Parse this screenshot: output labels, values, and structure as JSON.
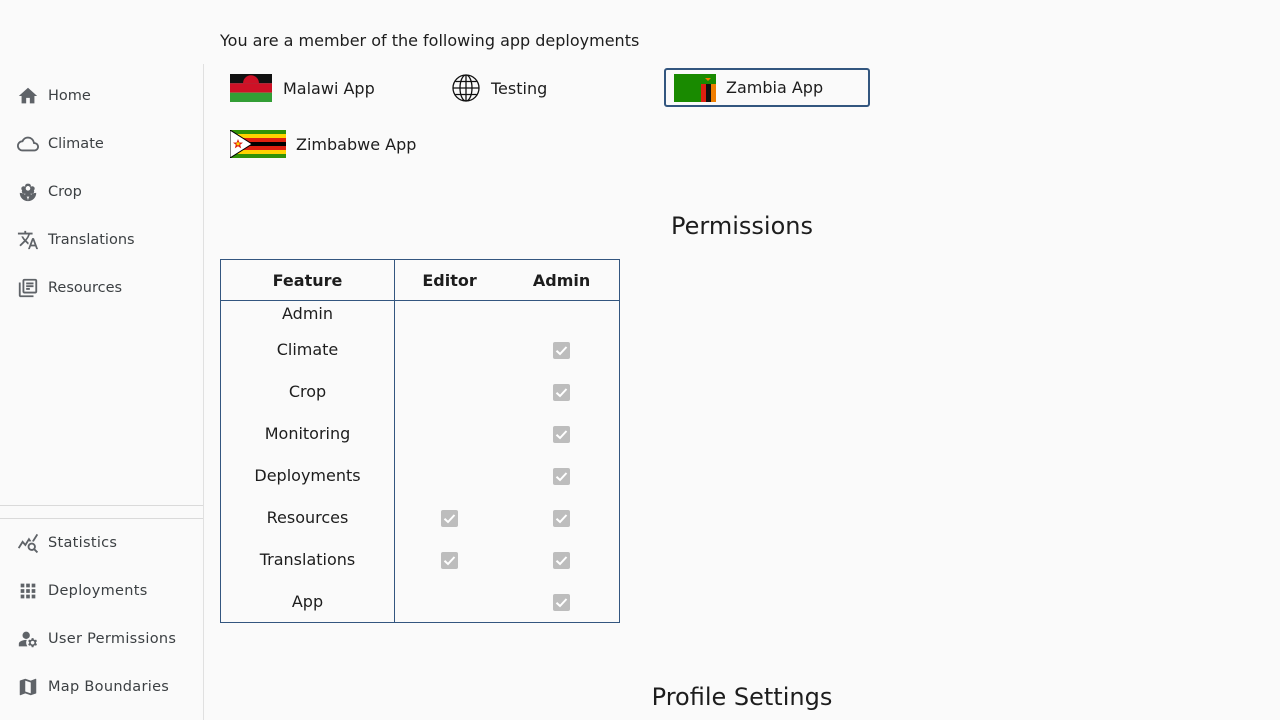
{
  "sidebar": {
    "items": [
      {
        "label": "Home",
        "icon": "home-icon"
      },
      {
        "label": "Climate",
        "icon": "cloud-icon"
      },
      {
        "label": "Crop",
        "icon": "sprout-icon"
      },
      {
        "label": "Translations",
        "icon": "translate-icon"
      },
      {
        "label": "Resources",
        "icon": "library-books-icon"
      }
    ],
    "bottom_items": [
      {
        "label": "Statistics",
        "icon": "chart-search-icon"
      },
      {
        "label": "Deployments",
        "icon": "grid-icon"
      },
      {
        "label": "User Permissions",
        "icon": "user-settings-icon"
      },
      {
        "label": "Map Boundaries",
        "icon": "map-icon"
      }
    ]
  },
  "main": {
    "member_text": "You are a member of the following app deployments",
    "deployments": [
      {
        "label": "Malawi App",
        "flag": "malawi-flag"
      },
      {
        "label": "Testing",
        "flag": "globe-icon"
      },
      {
        "label": "Zambia App",
        "flag": "zambia-flag",
        "selected": true
      },
      {
        "label": "Zimbabwe App",
        "flag": "zimbabwe-flag"
      }
    ],
    "permissions_title": "Permissions",
    "profile_title": "Profile Settings",
    "table": {
      "headers": [
        "Feature",
        "Editor",
        "Admin"
      ],
      "section_label": "Admin",
      "rows": [
        {
          "feature": "Climate",
          "editor": false,
          "admin": true
        },
        {
          "feature": "Crop",
          "editor": false,
          "admin": true
        },
        {
          "feature": "Monitoring",
          "editor": false,
          "admin": true
        },
        {
          "feature": "Deployments",
          "editor": false,
          "admin": true
        },
        {
          "feature": "Resources",
          "editor": true,
          "admin": true
        },
        {
          "feature": "Translations",
          "editor": true,
          "admin": true
        },
        {
          "feature": "App",
          "editor": false,
          "admin": true
        }
      ]
    }
  },
  "colors": {
    "accent": "#33567f",
    "checkbox_disabled": "#bdbdbd"
  }
}
